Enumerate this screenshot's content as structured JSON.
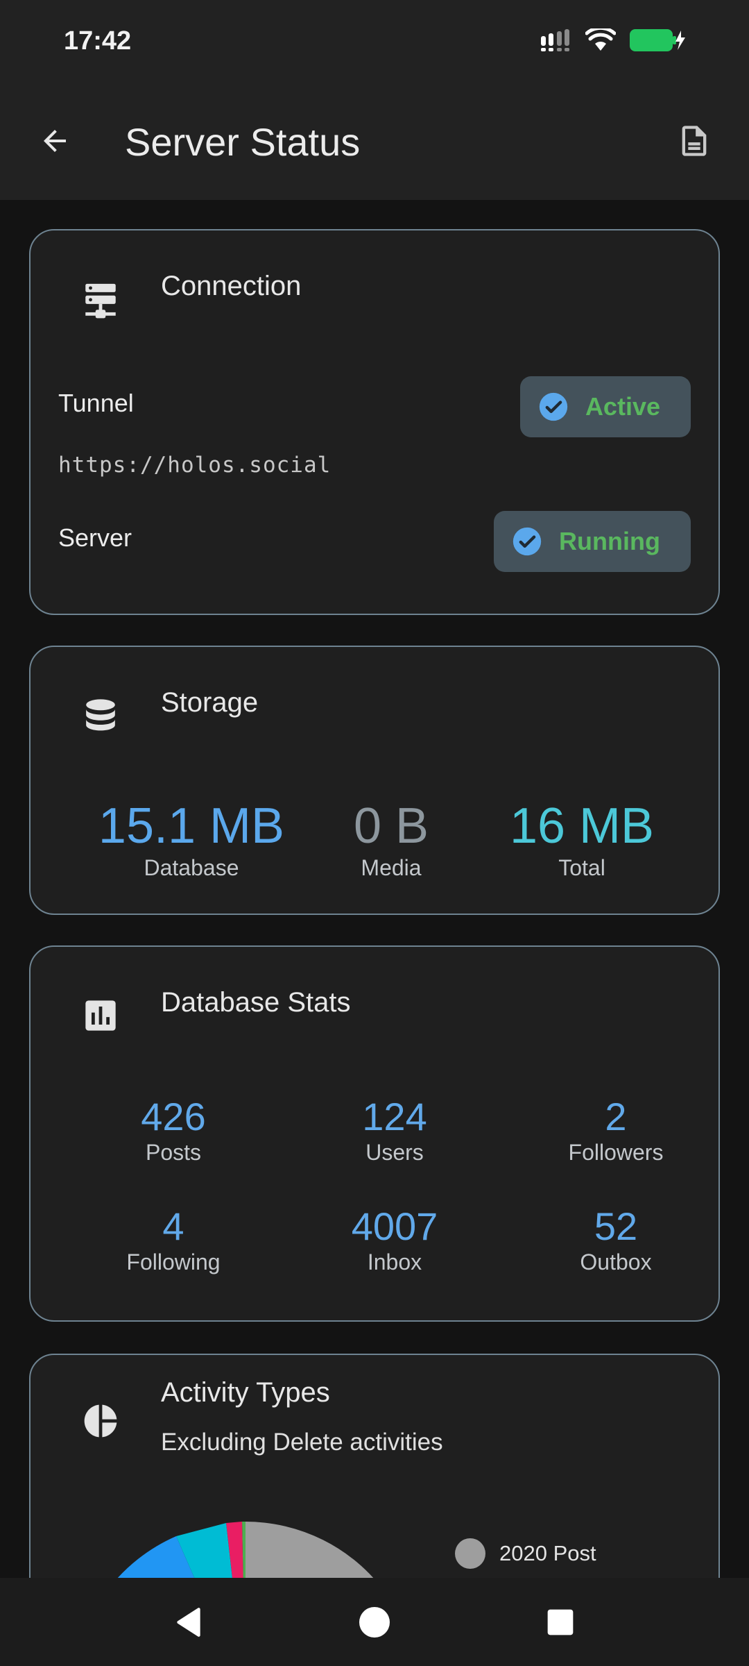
{
  "status_bar": {
    "time": "17:42",
    "icons": [
      "signal-icon",
      "wifi-icon",
      "battery-charging-icon"
    ],
    "battery_color": "#22c55e"
  },
  "app_bar": {
    "title": "Server Status",
    "back_icon": "arrow-back-icon",
    "action_icon": "document-icon"
  },
  "connection": {
    "title": "Connection",
    "icon": "server-icon",
    "tunnel_label": "Tunnel",
    "tunnel_status": "Active",
    "tunnel_url": "https://holos.social",
    "server_label": "Server",
    "server_status": "Running",
    "status_color": "#5ab85f"
  },
  "storage": {
    "title": "Storage",
    "icon": "database-icon",
    "items": [
      {
        "value": "15.1 MB",
        "label": "Database",
        "color": "#5ba8ec"
      },
      {
        "value": "0 B",
        "label": "Media",
        "color": "#8d979e"
      },
      {
        "value": "16 MB",
        "label": "Total",
        "color": "#4cc8d8"
      }
    ]
  },
  "db_stats": {
    "title": "Database Stats",
    "icon": "bar-chart-icon",
    "items": [
      {
        "value": "426",
        "label": "Posts"
      },
      {
        "value": "124",
        "label": "Users"
      },
      {
        "value": "2",
        "label": "Followers"
      },
      {
        "value": "4",
        "label": "Following"
      },
      {
        "value": "4007",
        "label": "Inbox"
      },
      {
        "value": "52",
        "label": "Outbox"
      }
    ]
  },
  "activity": {
    "title": "Activity Types",
    "subtitle": "Excluding Delete activities",
    "icon": "pie-chart-icon",
    "legend": [
      {
        "label": "2020 Post",
        "color": "#9e9e9e"
      }
    ]
  },
  "nav": {
    "icons": [
      "nav-back-icon",
      "nav-home-icon",
      "nav-recents-icon"
    ]
  }
}
